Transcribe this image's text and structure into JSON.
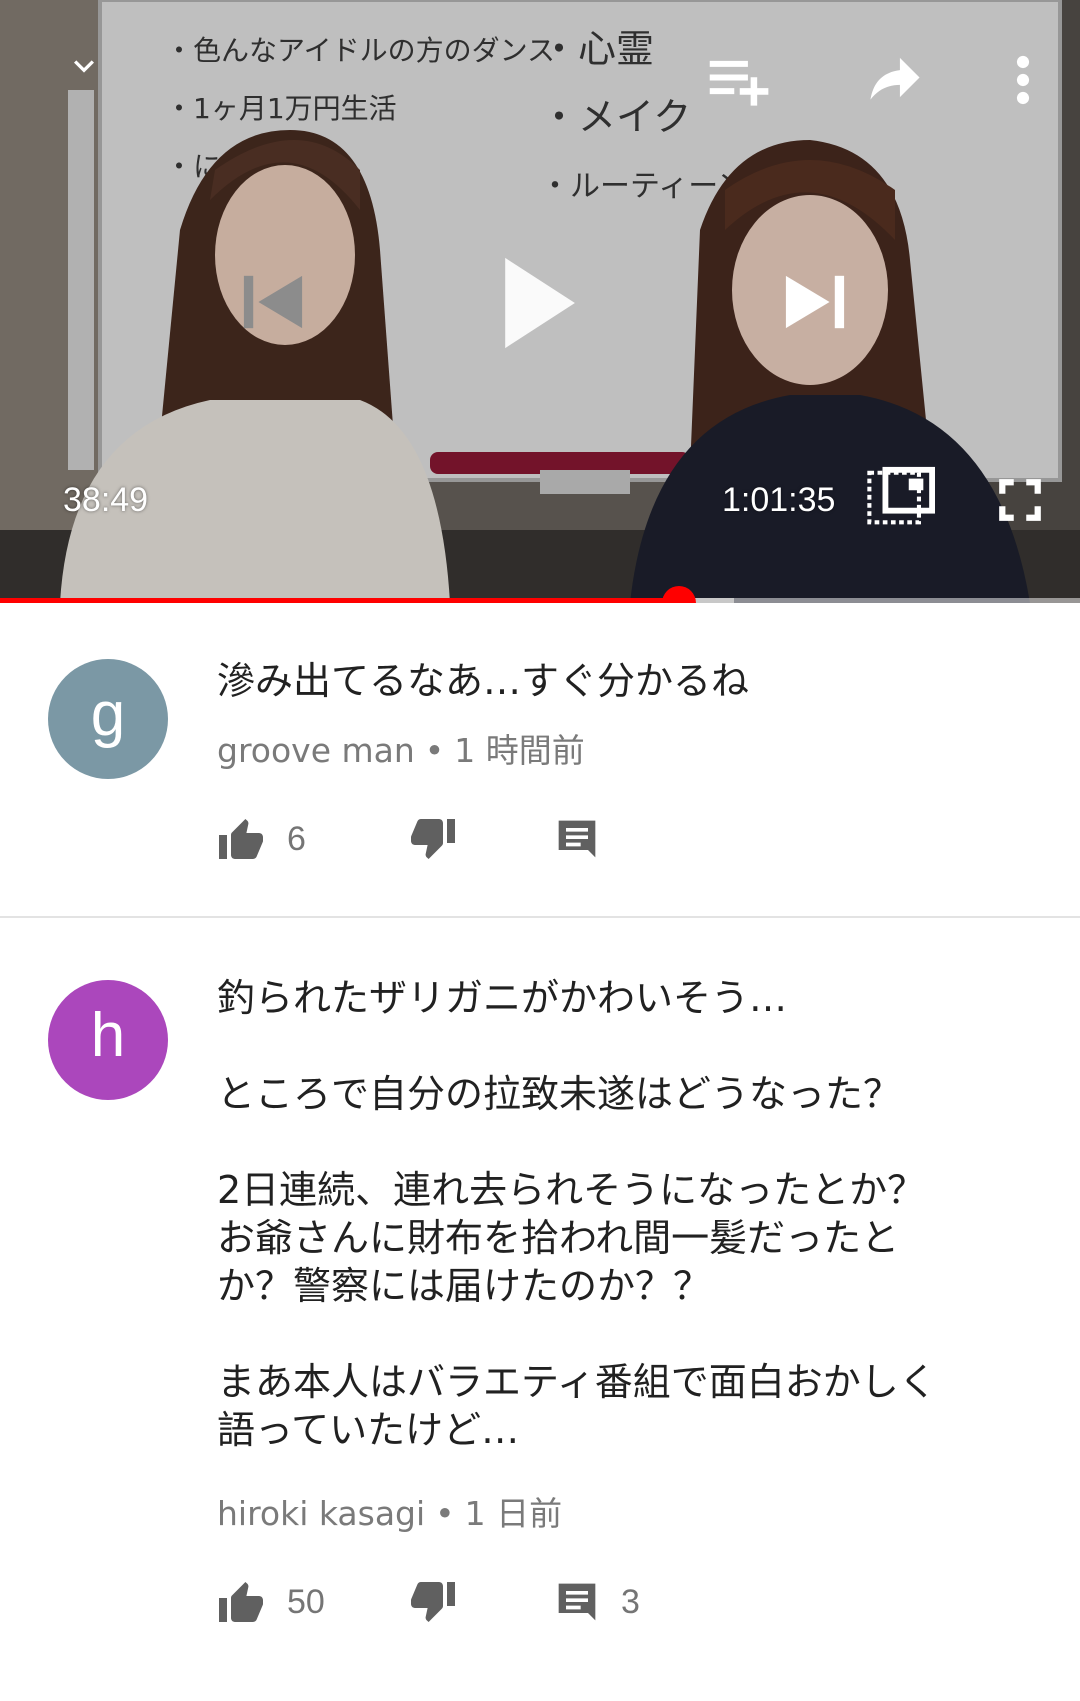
{
  "player": {
    "current_time": "38:49",
    "duration": "1:01:35",
    "progress_fraction": 0.629,
    "buffered_fraction": 0.68,
    "accent_color": "#ff0000",
    "icons": {
      "minimize": "chevron-down-icon",
      "add_to_queue": "playlist-add-icon",
      "share": "share-icon",
      "more": "more-vert-icon",
      "previous": "skip-previous-icon",
      "play": "play-icon",
      "next": "skip-next-icon",
      "miniplayer": "picture-in-picture-icon",
      "fullscreen": "fullscreen-icon"
    },
    "whiteboard_left": [
      "・色んなアイドルの方のダンス",
      "・1ヶ月1万円生活",
      "・に　　紹介"
    ],
    "whiteboard_right": [
      "・心霊",
      "・メイク",
      "・ルーティーン"
    ]
  },
  "comments": [
    {
      "avatar_letter": "g",
      "avatar_color": "#7b98a5",
      "text": "滲み出てるなあ…すぐ分かるね",
      "author": "groove man",
      "separator": "•",
      "time_ago": "1 時間前",
      "likes": "6",
      "replies": ""
    },
    {
      "avatar_letter": "h",
      "avatar_color": "#ab47bc",
      "text": "釣られたザリガニがかわいそう…\n\nところで自分の拉致未遂はどうなった？\n\n2日連続、連れ去られそうになったとか？\nお爺さんに財布を拾われ間一髪だったと\nか？警察には届けたのか？？\n\nまあ本人はバラエティ番組で面白おかしく\n語っていたけど…",
      "author": "hiroki kasagi",
      "separator": "•",
      "time_ago": "1 日前",
      "likes": "50",
      "replies": "3"
    }
  ]
}
